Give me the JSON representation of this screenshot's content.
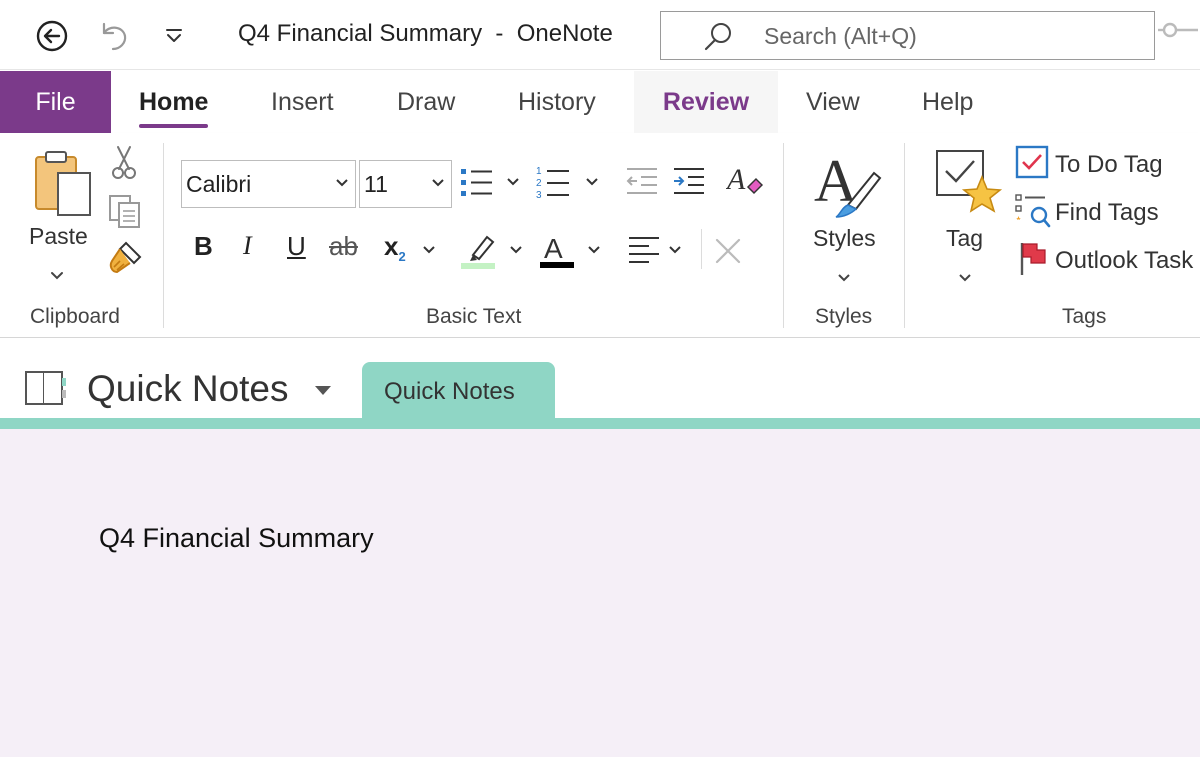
{
  "window": {
    "title": "Q4 Financial Summary  -  OneNote",
    "search_placeholder": "Search (Alt+Q)"
  },
  "tabs": [
    {
      "label": "File"
    },
    {
      "label": "Home"
    },
    {
      "label": "Insert"
    },
    {
      "label": "Draw"
    },
    {
      "label": "History"
    },
    {
      "label": "Review"
    },
    {
      "label": "View"
    },
    {
      "label": "Help"
    }
  ],
  "ribbon": {
    "clipboard": {
      "paste_label": "Paste",
      "group_label": "Clipboard"
    },
    "basic_text": {
      "font_name": "Calibri",
      "font_size": "11",
      "group_label": "Basic Text"
    },
    "styles": {
      "label": "Styles",
      "group_label": "Styles"
    },
    "tags": {
      "tag_label": "Tag",
      "todo_label": "To Do Tag",
      "find_label": "Find Tags",
      "outlook_label": "Outlook Task",
      "group_label": "Tags"
    }
  },
  "notebook": {
    "name": "Quick Notes",
    "section_tab": "Quick Notes"
  },
  "page": {
    "title": "Q4 Financial Summary"
  },
  "colors": {
    "accent": "#7b3a8a",
    "section": "#8fd6c5",
    "page_bg": "#f5eff7"
  }
}
